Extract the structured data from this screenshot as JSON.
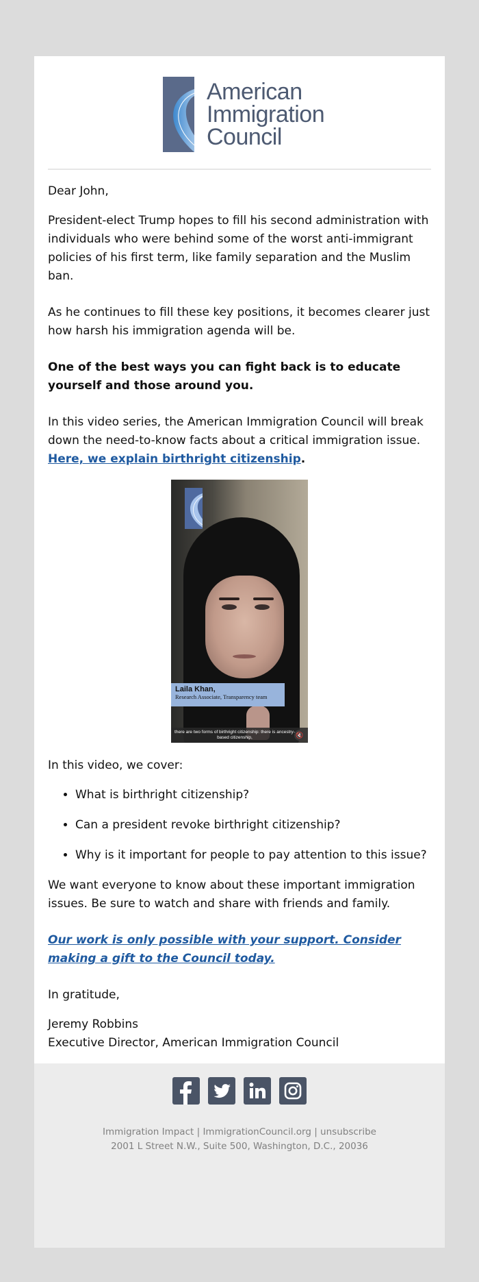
{
  "header": {
    "logo_lines": [
      "American",
      "Immigration",
      "Council"
    ]
  },
  "body": {
    "greeting": "Dear John,",
    "paragraph1": "President-elect Trump hopes to fill his second administration with individuals who were behind some of the worst anti-immigrant policies of his first term, like family separation and the Muslim ban.",
    "paragraph2": "As he continues to fill these key positions, it becomes clearer just how harsh his immigration agenda will be.",
    "paragraph3_bold": "One of the best ways you can fight back is to educate yourself and those around you.",
    "paragraph4_text": "In this video series, the American Immigration Council will break down the need-to-know facts about a critical immigration issue. ",
    "paragraph4_link": "Here, we explain birthright citizenship",
    "paragraph4_end": ".",
    "video": {
      "speaker_name": "Laila Khan,",
      "speaker_role": "Research Associate, Transparency team",
      "caption": "there are two forms of birthright citizenship: there is ancestry-based citizenship,",
      "mute_icon": "muted-speaker-icon"
    },
    "list_intro": "In this video, we cover:",
    "list_items": [
      "What is birthright citizenship?",
      "Can a president revoke birthright citizenship?",
      "Why is it important for people to pay attention to this issue?"
    ],
    "paragraph5": "We want everyone to know about these important immigration issues. Be sure to watch and share with friends and family.",
    "cta_link": "Our work is only possible with your support. Consider making a gift to the Council today.",
    "closing": "In gratitude,",
    "signer_name": "Jeremy Robbins",
    "signer_title": "Executive Director, American Immigration Council"
  },
  "footer": {
    "social": [
      {
        "name": "facebook",
        "glyph": "f"
      },
      {
        "name": "twitter",
        "glyph": "🐦"
      },
      {
        "name": "linkedin",
        "glyph": "in"
      },
      {
        "name": "instagram",
        "glyph": "◎"
      }
    ],
    "link_immigration_impact": "Immigration Impact",
    "link_site": "ImmigrationCouncil.org",
    "link_unsubscribe": "unsubscribe",
    "separator": " | ",
    "address": "2001 L Street N.W., Suite 500, Washington, D.C., 20036"
  },
  "colors": {
    "link": "#1f5aa0",
    "logo_blue": "#5a6a8a",
    "social_bg": "#4a5466",
    "page_bg": "#dcdcdc",
    "footer_bg": "#ececec"
  }
}
